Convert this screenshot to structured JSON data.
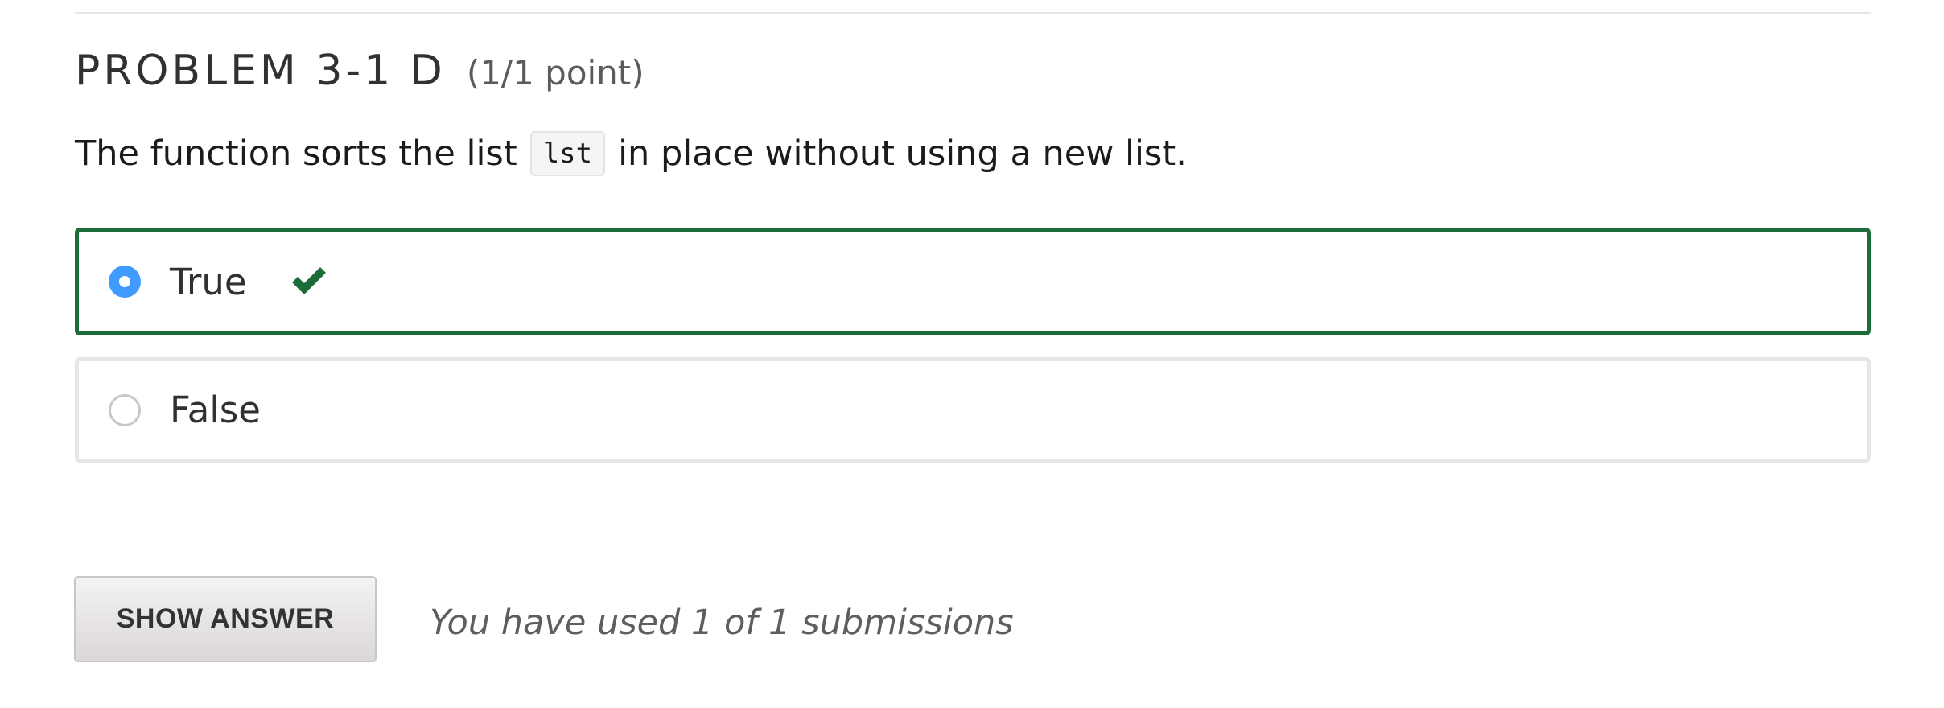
{
  "problem": {
    "title": "PROBLEM 3-1 D",
    "points": "(1/1 point)",
    "prompt_before": "The function sorts the list",
    "prompt_code": "lst",
    "prompt_after": "in place without using a new list."
  },
  "choices": [
    {
      "label": "True",
      "selected": true,
      "status": "correct",
      "status_icon": "checkmark-icon"
    },
    {
      "label": "False",
      "selected": false
    }
  ],
  "actions": {
    "show_answer_label": "SHOW ANSWER",
    "submissions_text": "You have used 1 of 1 submissions"
  },
  "colors": {
    "correct_border": "#1e6b3a",
    "radio_selected": "#3f9bff",
    "checkmark": "#1e6b3a"
  }
}
